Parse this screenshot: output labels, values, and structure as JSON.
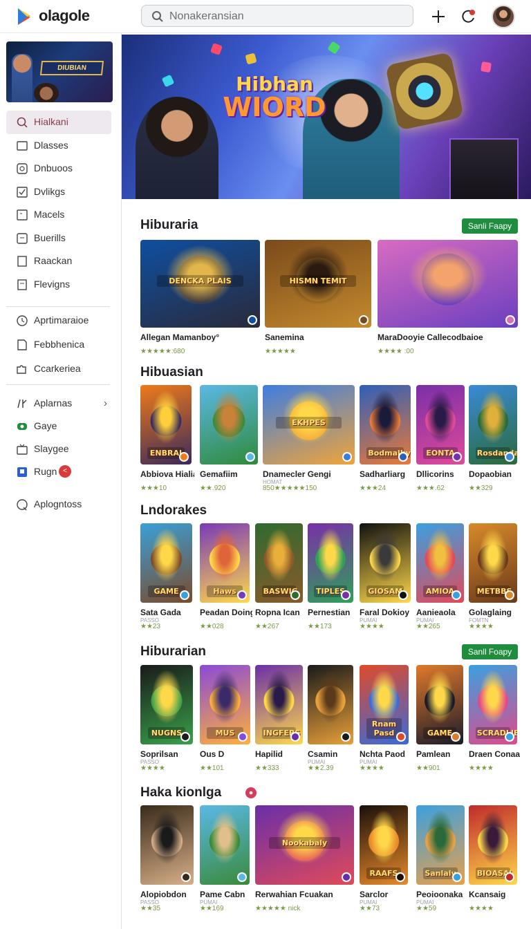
{
  "app": {
    "brand": "olagole"
  },
  "search": {
    "placeholder": "Nonakeransian"
  },
  "topbar_icons": [
    "plus-icon",
    "notification-icon",
    "avatar"
  ],
  "colors": {
    "accent_green": "#1e8e3e",
    "nav_active_bg": "#ede9ee",
    "rating_green": "#7a9a45",
    "badge_red": "#d93a3a"
  },
  "sidebar": {
    "banner": {
      "title": "DIUBIAN"
    },
    "items": [
      {
        "label": "Hialkani",
        "icon": "search-icon",
        "active": true
      },
      {
        "label": "Dlasses",
        "icon": "classes-icon"
      },
      {
        "label": "Dnbuoos",
        "icon": "box-icon"
      },
      {
        "label": "Dvlikgs",
        "icon": "check-icon"
      },
      {
        "label": "Macels",
        "icon": "square-icon"
      },
      {
        "label": "Buerills",
        "icon": "tag-icon"
      },
      {
        "label": "Raackan",
        "icon": "note-icon"
      },
      {
        "label": "Flevigns",
        "icon": "flag-icon"
      }
    ],
    "items2": [
      {
        "label": "Aprtimaraioe",
        "icon": "clock-icon"
      },
      {
        "label": "Febbhenica",
        "icon": "page-icon"
      },
      {
        "label": "Ccarkeriea",
        "icon": "puzzle-icon"
      }
    ],
    "items3": [
      {
        "label": "Aplarnas",
        "icon": "apps-icon",
        "chevron": "›"
      },
      {
        "label": "Gaye",
        "icon": "gamepad-icon"
      },
      {
        "label": "Slaygee",
        "icon": "tv-icon"
      },
      {
        "label": "Rugn",
        "icon": "bookmark-icon",
        "badge": "<"
      }
    ],
    "items4": [
      {
        "label": "Aplogntoss",
        "icon": "question-icon"
      }
    ]
  },
  "hero": {
    "title_line1": "Hibhan",
    "title_line2": "WIORD"
  },
  "sections": [
    {
      "title": "Hiburaria",
      "see_all": "Sanli Faapy",
      "cards": [
        {
          "name": "Allegan Mamanboy°",
          "rating": "★★★★★:680",
          "emblem": "DENCKA PLAIS",
          "palette": [
            "#0f4fa0",
            "#2a2a3a",
            "#e2b64b"
          ]
        },
        {
          "name": "Sanemina",
          "rating": "★★★★★",
          "emblem": "HISMN TEMIT",
          "palette": [
            "#7a4a1a",
            "#c48a2e",
            "#2a1a10"
          ]
        },
        {
          "name": "MaraDooyie Callecodbaioe",
          "rating": "★★★★ :00",
          "emblem": "",
          "palette": [
            "#d86bc1",
            "#6a3fbf",
            "#f3a36b"
          ]
        }
      ]
    },
    {
      "title": "Hibuasian",
      "cards": [
        {
          "name": "Abbiova Hialias",
          "rating": "★★★10",
          "emblem": "ENBRAI",
          "palette": [
            "#f07a1a",
            "#3a2a5a",
            "#ffcf3a"
          ]
        },
        {
          "name": "Gemafiim",
          "sub": "",
          "rating": "★★.920",
          "emblem": "",
          "palette": [
            "#5bb8e6",
            "#2f8a3a",
            "#c9823a"
          ]
        },
        {
          "name": "Dnamecler Gengi",
          "sub": "HOMAT",
          "rating": "850★★★★★150",
          "emblem": "EKHPES",
          "palette": [
            "#3e7de0",
            "#f0a43a",
            "#ffd84a"
          ]
        },
        {
          "name": "Sadharliarg",
          "sub": "",
          "rating": "★★★24",
          "emblem": "Bodmalby",
          "palette": [
            "#2f5fb8",
            "#e87a3a",
            "#1a1a3a"
          ]
        },
        {
          "name": "Dllicorins",
          "sub": "",
          "rating": "★★★.62",
          "emblem": "EONTA",
          "palette": [
            "#7a2fa8",
            "#e04a9a",
            "#2a1a4a"
          ]
        },
        {
          "name": "Dopaobian",
          "sub": "",
          "rating": "★★329",
          "emblem": "Rosdandar",
          "palette": [
            "#3a8ad8",
            "#2a6a3a",
            "#e0b03a"
          ]
        }
      ]
    },
    {
      "title": "Lndorakes",
      "cards": [
        {
          "name": "Sata Gada",
          "sub": "PASSO",
          "rating": "★★23",
          "emblem": "GAME",
          "palette": [
            "#3aa0d8",
            "#7a4a2a",
            "#ffd84a"
          ]
        },
        {
          "name": "Peadan Doing",
          "sub": "",
          "rating": "★★028",
          "emblem": "Haws",
          "palette": [
            "#7a3ab8",
            "#ffd84a",
            "#e0643a"
          ]
        },
        {
          "name": "Ropna Ican",
          "sub": "",
          "rating": "★★267",
          "emblem": "BASWIG",
          "palette": [
            "#2f6a2f",
            "#8a5a2a",
            "#e8b03a"
          ]
        },
        {
          "name": "Pernestian",
          "sub": "",
          "rating": "★★173",
          "emblem": "TIPLES",
          "palette": [
            "#7a2fa8",
            "#2fa05a",
            "#ffd84a"
          ]
        },
        {
          "name": "Faral Dokioy",
          "sub": "PUMAI",
          "rating": "★★★★",
          "emblem": "GIOSAM",
          "palette": [
            "#111111",
            "#ffd84a",
            "#3a3a3a"
          ]
        },
        {
          "name": "Aanieaola",
          "sub": "PUMAI",
          "rating": "★★265",
          "emblem": "AMIOA",
          "palette": [
            "#3aa0e0",
            "#e04a5a",
            "#f0c040"
          ]
        },
        {
          "name": "Golaglaing",
          "sub": "FOMTN",
          "rating": "★★★★",
          "emblem": "METBBS",
          "palette": [
            "#d88a2a",
            "#6a3a1a",
            "#ffd84a"
          ]
        }
      ]
    },
    {
      "title": "Hiburarian",
      "see_all": "Sanll Foapy",
      "cards": [
        {
          "name": "Soprilsan",
          "sub": "PASSO",
          "rating": "★★★★",
          "emblem": "NUGNS",
          "palette": [
            "#1a1a1a",
            "#3aa04a",
            "#ffd84a"
          ]
        },
        {
          "name": "Ous D",
          "sub": "",
          "rating": "★★101",
          "emblem": "MUS",
          "palette": [
            "#8a4ad8",
            "#ffb03a",
            "#3a2a6a"
          ]
        },
        {
          "name": "Hapilid",
          "sub": "",
          "rating": "★★333",
          "emblem": "INGFERS",
          "palette": [
            "#6a2fa8",
            "#ffd84a",
            "#2a1a4a"
          ]
        },
        {
          "name": "Csamin",
          "sub": "PUMAI",
          "rating": "★★2.39",
          "emblem": "",
          "palette": [
            "#1a1a1a",
            "#e8a03a",
            "#5a3a1a"
          ]
        },
        {
          "name": "Nchta Paod",
          "sub": "PUMAI",
          "rating": "★★★★",
          "emblem": "Rnam Pasd",
          "palette": [
            "#e04a2a",
            "#3a6ad8",
            "#ffd84a"
          ]
        },
        {
          "name": "Pamlean",
          "sub": "",
          "rating": "★★901",
          "emblem": "GAME",
          "palette": [
            "#e07a2a",
            "#1a1a2a",
            "#ffd84a"
          ]
        },
        {
          "name": "Draen Conaa",
          "sub": "",
          "rating": "★★★★",
          "emblem": "SCRADLIER",
          "palette": [
            "#3aa0e0",
            "#e04a8a",
            "#ffd84a"
          ]
        }
      ]
    },
    {
      "title": "Haka kionlga",
      "cards": [
        {
          "name": "Alopiobdon",
          "sub": "PASSO",
          "rating": "★★35",
          "emblem": "",
          "palette": [
            "#3a2a1a",
            "#d8b08a",
            "#1a1a1a"
          ]
        },
        {
          "name": "Pame Cabn",
          "sub": "PUMAI",
          "rating": "★★169",
          "emblem": "",
          "palette": [
            "#5ab8e6",
            "#3a8a3a",
            "#e0c08a"
          ]
        },
        {
          "name": "Rerwahian Fcuakan",
          "sub": "",
          "rating": "★★★★★ nick",
          "emblem": "Nookabaly",
          "palette": [
            "#6a2fa8",
            "#e04a5a",
            "#ffd84a"
          ]
        },
        {
          "name": "Sarclor",
          "sub": "PUMAI",
          "rating": "★★73",
          "emblem": "RAAFS",
          "palette": [
            "#1a0f0a",
            "#e88a2a",
            "#ffd84a"
          ]
        },
        {
          "name": "Peoioonaka",
          "sub": "PUMAI",
          "rating": "★★59",
          "emblem": "Sanlaly",
          "palette": [
            "#3aa0e0",
            "#e8a04a",
            "#2a6a3a"
          ]
        },
        {
          "name": "Kcansaig",
          "sub": "",
          "rating": "★★★★",
          "emblem": "BIOASAL",
          "palette": [
            "#c02a2a",
            "#ffd84a",
            "#3a1a3a"
          ]
        }
      ]
    }
  ]
}
